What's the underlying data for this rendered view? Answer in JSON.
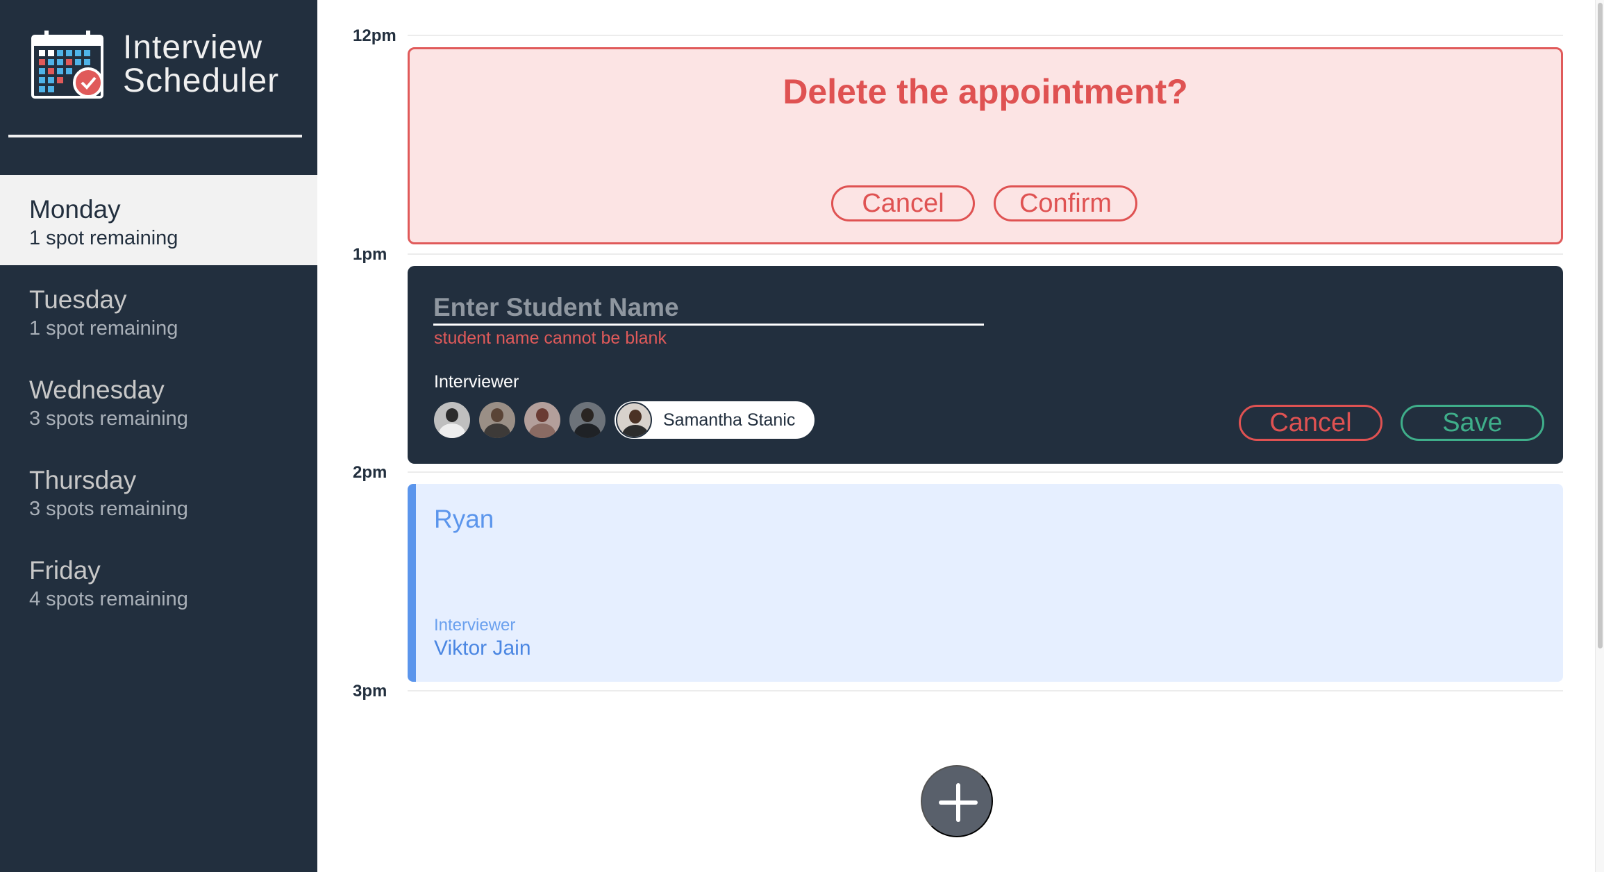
{
  "app": {
    "title_line1": "Interview",
    "title_line2": "Scheduler"
  },
  "days": [
    {
      "name": "Monday",
      "spots": "1 spot remaining",
      "selected": true
    },
    {
      "name": "Tuesday",
      "spots": "1 spot remaining",
      "selected": false
    },
    {
      "name": "Wednesday",
      "spots": "3 spots remaining",
      "selected": false
    },
    {
      "name": "Thursday",
      "spots": "3 spots remaining",
      "selected": false
    },
    {
      "name": "Friday",
      "spots": "4 spots remaining",
      "selected": false
    }
  ],
  "times": [
    "12pm",
    "1pm",
    "2pm",
    "3pm"
  ],
  "confirm": {
    "message": "Delete the appointment?",
    "cancel_label": "Cancel",
    "confirm_label": "Confirm"
  },
  "form": {
    "name_value": "",
    "name_placeholder": "Enter Student Name",
    "validation_message": "student name cannot be blank",
    "interviewer_label": "Interviewer",
    "selected_interviewer": "Samantha Stanic",
    "cancel_label": "Cancel",
    "save_label": "Save"
  },
  "show": {
    "student": "Ryan",
    "interviewer_label": "Interviewer",
    "interviewer_name": "Viktor Jain"
  },
  "colors": {
    "sidebar_bg": "#222f3e",
    "danger": "#df5252",
    "success": "#3fae8a",
    "show_accent": "#5b95ec"
  },
  "icons": {
    "add": "plus-icon",
    "logo": "calendar-check-icon"
  }
}
